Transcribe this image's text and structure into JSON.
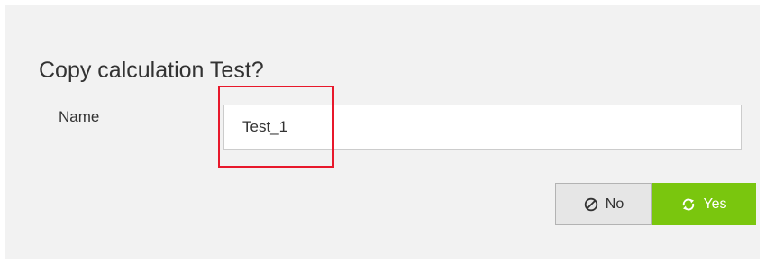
{
  "dialog": {
    "title": "Copy calculation Test?",
    "name_label": "Name",
    "name_value": "Test_1"
  },
  "buttons": {
    "no_label": "No",
    "yes_label": "Yes",
    "no_icon": "ban-icon",
    "yes_icon": "refresh-icon"
  },
  "colors": {
    "yes_bg": "#7ac60e",
    "highlight": "#e8182b"
  }
}
